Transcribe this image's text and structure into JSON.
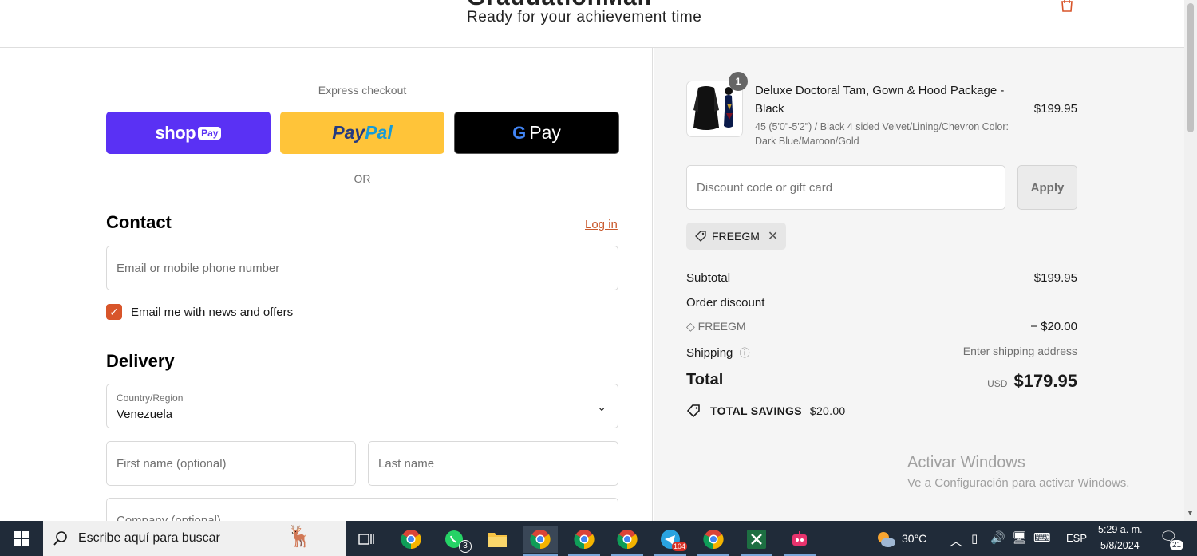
{
  "header": {
    "brand": "GraduationMall",
    "tagline": "Ready for your achievement time"
  },
  "express": {
    "title": "Express checkout",
    "shop_label": "shop",
    "shop_pay_badge": "Pay",
    "paypal_a": "Pay",
    "paypal_b": "Pal",
    "gpay_g": "G",
    "gpay_label": "Pay",
    "or": "OR"
  },
  "contact": {
    "heading": "Contact",
    "login": "Log in",
    "email_placeholder": "Email or mobile phone number",
    "news_label": "Email me with news and offers",
    "news_checked": true
  },
  "delivery": {
    "heading": "Delivery",
    "country_label": "Country/Region",
    "country_value": "Venezuela",
    "first_name_placeholder": "First name (optional)",
    "last_name_placeholder": "Last name",
    "company_placeholder": "Company (optional)"
  },
  "summary": {
    "item_qty": "1",
    "item_name": "Deluxe Doctoral Tam, Gown & Hood Package - Black",
    "item_variant": "45 (5'0\"-5'2\") / Black 4 sided Velvet/Lining/Chevron Color: Dark Blue/Maroon/Gold",
    "item_price": "$199.95",
    "discount_placeholder": "Discount code or gift card",
    "apply": "Apply",
    "applied_code": "FREEGM",
    "subtotal_label": "Subtotal",
    "subtotal_value": "$199.95",
    "order_discount_label": "Order discount",
    "discount_code": "FREEGM",
    "discount_value": "− $20.00",
    "shipping_label": "Shipping",
    "shipping_value": "Enter shipping address",
    "total_label": "Total",
    "total_currency": "USD",
    "total_value": "$179.95",
    "savings_label": "TOTAL SAVINGS",
    "savings_value": "$20.00"
  },
  "watermark": {
    "line1": "Activar Windows",
    "line2": "Ve a Configuración para activar Windows."
  },
  "taskbar": {
    "search_placeholder": "Escribe aquí para buscar",
    "whatsapp_badge": "3",
    "telegram_badge": "104",
    "temperature": "30°C",
    "language": "ESP",
    "time": "5:29 a. m.",
    "date": "5/8/2024",
    "notification_count": "21"
  },
  "colors": {
    "accent": "#d8552a",
    "shop_pay": "#5a31f4",
    "paypal": "#ffc439",
    "taskbar": "#202b39"
  }
}
